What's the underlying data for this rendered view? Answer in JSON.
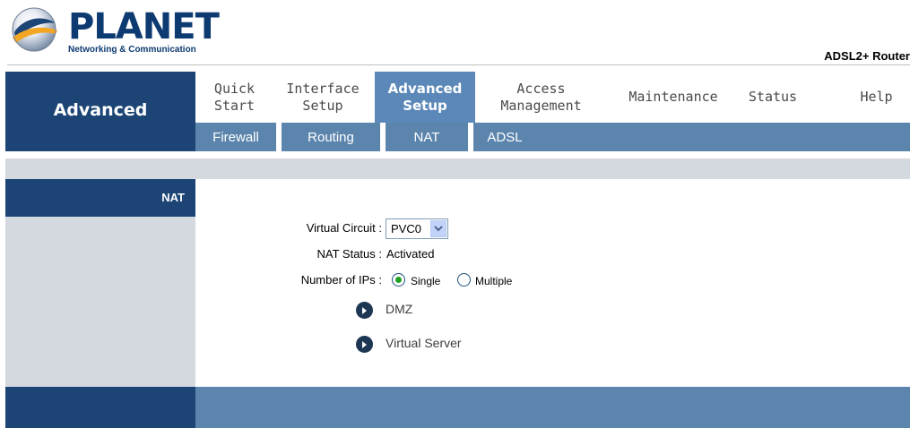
{
  "brand": {
    "logo_text": "PLANET",
    "logo_subtitle": "Networking & Communication",
    "product_name": "ADSL2+ Router"
  },
  "section_title": "Advanced",
  "nav": {
    "items": [
      {
        "label": "Quick\nStart",
        "active": false
      },
      {
        "label": "Interface\nSetup",
        "active": false
      },
      {
        "label": "Advanced\nSetup",
        "active": true
      },
      {
        "label": "Access\nManagement",
        "active": false
      },
      {
        "label": "Maintenance",
        "active": false
      },
      {
        "label": "Status",
        "active": false
      },
      {
        "label": "Help",
        "active": false
      }
    ]
  },
  "subnav": {
    "items": [
      {
        "label": "Firewall",
        "active": false
      },
      {
        "label": "Routing",
        "active": false
      },
      {
        "label": "NAT",
        "active": true
      },
      {
        "label": "ADSL",
        "active": false
      }
    ]
  },
  "sidebar": {
    "label": "NAT"
  },
  "form": {
    "virtual_circuit_label": "Virtual Circuit :",
    "virtual_circuit_value": "PVC0",
    "nat_status_label": "NAT Status :",
    "nat_status_value": "Activated",
    "num_ips_label": "Number of IPs :",
    "num_ips_options": [
      {
        "label": "Single",
        "selected": true
      },
      {
        "label": "Multiple",
        "selected": false
      }
    ]
  },
  "links": {
    "dmz": "DMZ",
    "virtual_server": "Virtual Server"
  },
  "colors": {
    "navy": "#1c4575",
    "nav_active": "#5b88b8",
    "subnav": "#5c85ad",
    "light_gray": "#d4d9df",
    "radio_selected": "#21a121"
  }
}
